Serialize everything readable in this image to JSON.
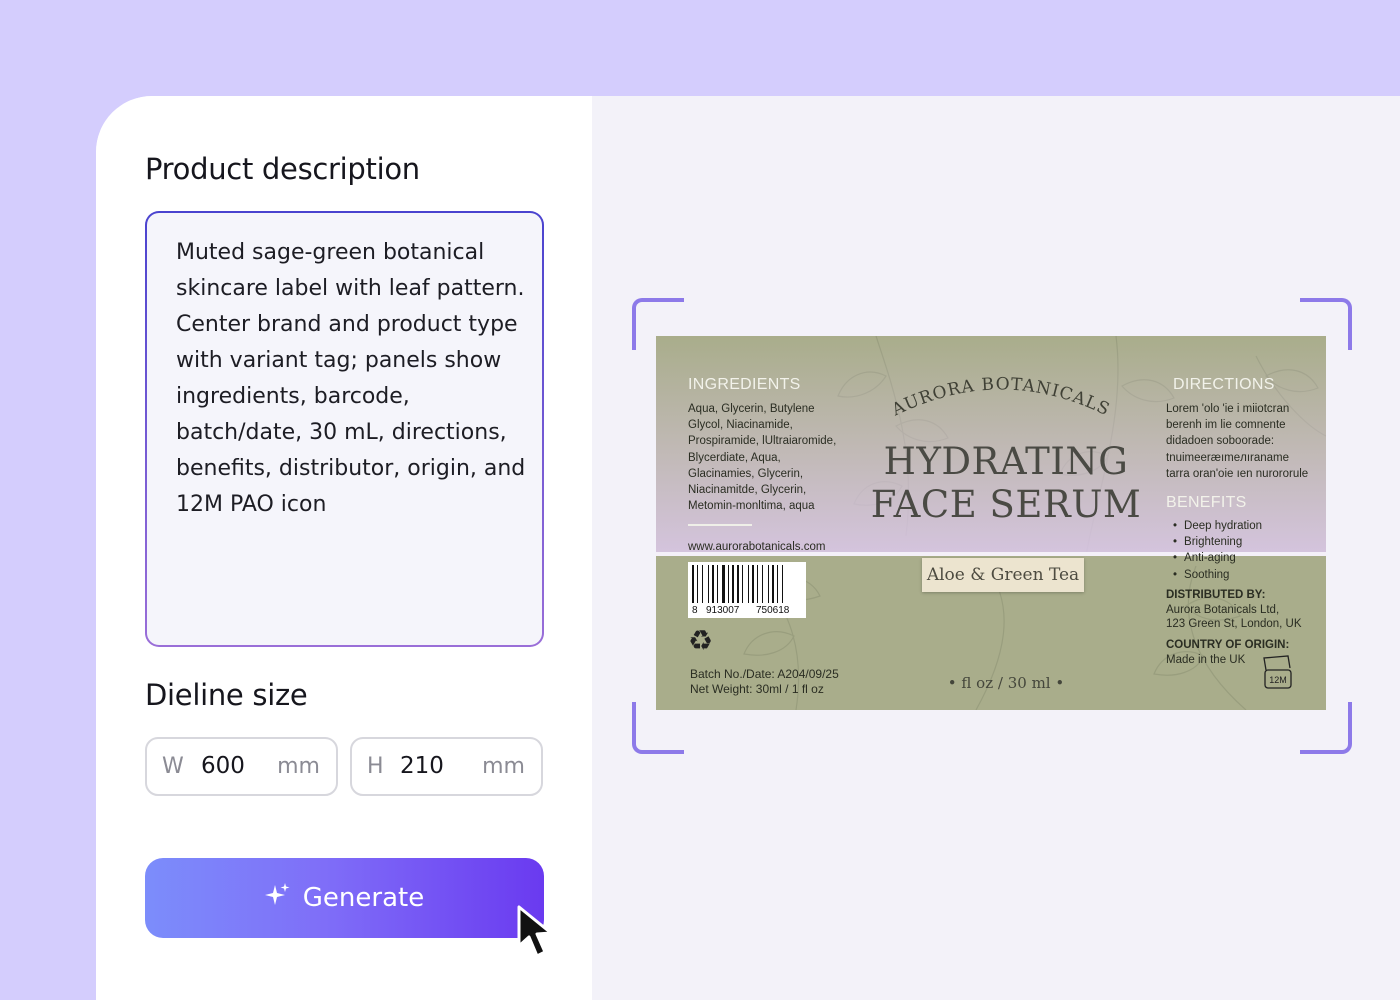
{
  "left_panel": {
    "description_title": "Product description",
    "description_text": "Muted sage-green botanical skincare label with leaf pattern. Center brand and product type with variant tag; panels show ingredients, barcode, batch/date, 30 mL, directions, benefits, distributor, origin, and 12M PAO icon",
    "dieline_title": "Dieline size",
    "width_field": {
      "prefix": "W",
      "value": "600",
      "unit": "mm"
    },
    "height_field": {
      "prefix": "H",
      "value": "210",
      "unit": "mm"
    },
    "generate_label": "Generate",
    "generate_icon": "sparkle-icon"
  },
  "label": {
    "brand": "AURORA BOTANICALS",
    "title_line1": "HYDRATING",
    "title_line2": "FACE SERUM",
    "variant": "Aloe & Green Tea",
    "volume": "• fl oz / 30 ml •",
    "ingredients_heading": "INGREDIENTS",
    "ingredients_lines": [
      "Aqua, Glycerin, Butylene",
      "Glycol, Niacinamide,",
      "Prospiramide, lUltraiaromide,",
      "Blycerdiate, Aqua,",
      "Glacinamies, Glycerin,",
      "Niacinamitde, Glycerin,",
      "Metomin-monltima, aqua"
    ],
    "website": "www.aurorabotanicals.com",
    "barcode_digits": [
      "8",
      "913007",
      "750618"
    ],
    "batch": "Batch No./Date: A204/09/25",
    "net_weight": "Net Weight: 30ml / 1 fl oz",
    "directions_heading": "DIRECTIONS",
    "directions_lines": [
      "Lorem 'olo 'ie i miiotcran",
      "berenh im lie comnente",
      "didadoen soboorade:",
      "tnuimeeræımeлıraname",
      "tarra oran'oie ıen nurororule"
    ],
    "benefits_heading": "BENEFITS",
    "benefits": [
      "Deep hydration",
      "Brightening",
      "Anti-aging",
      "Soothing"
    ],
    "distributed_heading": "DISTRIBUTED BY:",
    "distributor_lines": [
      "Aurora Botanicals Ltd,",
      "123 Green St, London, UK"
    ],
    "origin_heading": "COUNTRY OF ORIGIN:",
    "origin": "Made in the UK",
    "pao": "12M",
    "colors": {
      "base": "#a9ad8b",
      "tint": "#dcc8ec",
      "heading": "#f2f2ea"
    }
  }
}
